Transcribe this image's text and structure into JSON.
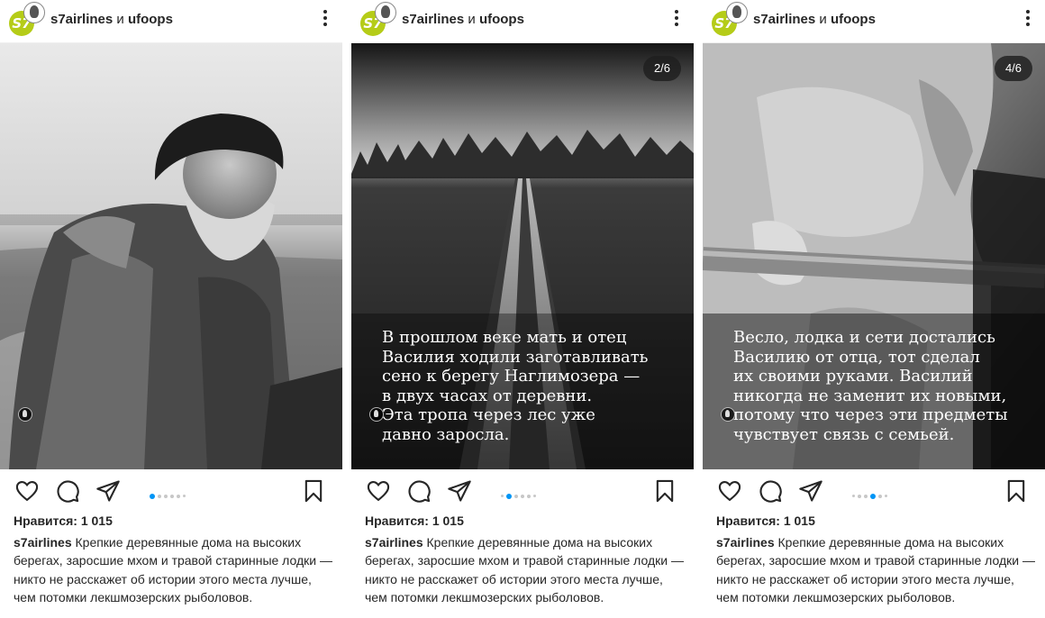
{
  "posts": [
    {
      "account": {
        "user1": "s7airlines",
        "joiner": "и",
        "user2": "ufoops"
      },
      "avatar": {
        "logo_text": "S7"
      },
      "counter": "",
      "overlay_text": "",
      "likes": "Нравится: 1 015",
      "caption_user": "s7airlines",
      "caption_text": "Крепкие деревянные дома на высоких берегах, заросшие мхом и травой старинные лодки — никто не расскажет об истории этого места лучше, чем потомки лекшмозерских рыболовов.",
      "carousel_active": 0
    },
    {
      "account": {
        "user1": "s7airlines",
        "joiner": "и",
        "user2": "ufoops"
      },
      "avatar": {
        "logo_text": "S7"
      },
      "counter": "2/6",
      "overlay_text": "В прошлом веке мать и отец\nВасилия ходили заготавливать\nсено к берегу Наглимозера —\nв двух часах от деревни.\nЭта тропа через лес уже\nдавно заросла.",
      "likes": "Нравится: 1 015",
      "caption_user": "s7airlines",
      "caption_text": "Крепкие деревянные дома на высоких берегах, заросшие мхом и травой старинные лодки — никто не расскажет об истории этого места лучше, чем потомки лекшмозерских рыболовов.",
      "carousel_active": 1
    },
    {
      "account": {
        "user1": "s7airlines",
        "joiner": "и",
        "user2": "ufoops"
      },
      "avatar": {
        "logo_text": "S7"
      },
      "counter": "4/6",
      "overlay_text": "Весло, лодка и сети достались\nВасилию от отца, тот сделал\nих своими руками. Василий\nникогда не заменит их новыми,\nпотому что через эти предметы\nчувствует связь с семьей.",
      "likes": "Нравится: 1 015",
      "caption_user": "s7airlines",
      "caption_text": "Крепкие деревянные дома на высоких берегах, заросшие мхом и травой старинные лодки — никто не расскажет об истории этого места лучше, чем потомки лекшмозерских рыболовов.",
      "carousel_active": 3
    }
  ],
  "icons": {
    "like": "heart-icon",
    "comment": "comment-icon",
    "share": "share-icon",
    "save": "bookmark-icon",
    "more": "more-vertical-icon",
    "tag": "tagged-user-icon"
  },
  "colors": {
    "accent": "#0095f6",
    "brand": "#b5cc18",
    "text": "#262626"
  }
}
